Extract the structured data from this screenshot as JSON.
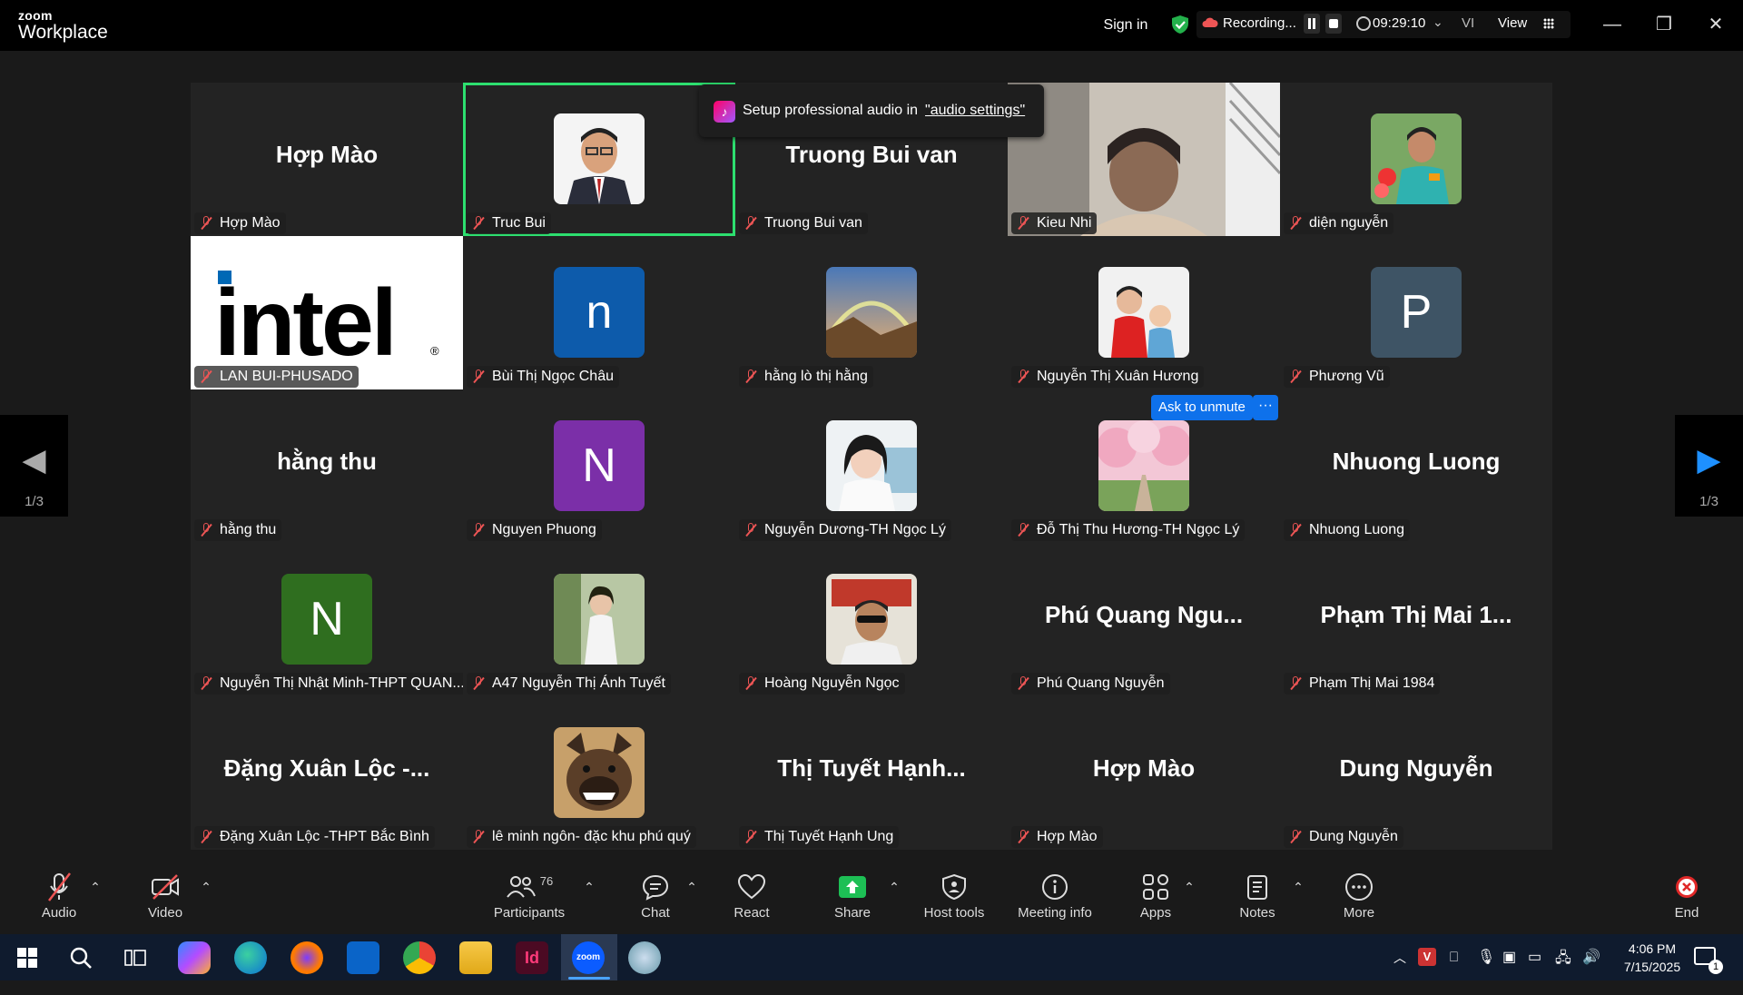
{
  "app": {
    "logo_top": "zoom",
    "logo_bottom": "Workplace"
  },
  "titlebar": {
    "signin": "Sign in",
    "recording": "Recording...",
    "timer": "09:29:10",
    "language": "VI",
    "view": "View"
  },
  "toast": {
    "text": "Setup professional audio in",
    "link": "\"audio settings\""
  },
  "participants": [
    {
      "display": "Hợp Mào",
      "label": "Hợp Mào"
    },
    {
      "display": "",
      "label": "Truc Bui"
    },
    {
      "display": "Truong Bui van",
      "label": "Truong Bui van"
    },
    {
      "display": "",
      "label": "Kieu Nhi"
    },
    {
      "display": "",
      "label": "diện nguyễn"
    },
    {
      "display": "intel",
      "label": "LAN BUI-PHUSADO"
    },
    {
      "display": "n",
      "label": "Bùi Thị Ngọc Châu"
    },
    {
      "display": "",
      "label": "hằng lò thị hằng"
    },
    {
      "display": "",
      "label": "Nguyễn Thị Xuân Hương"
    },
    {
      "display": "P",
      "label": "Phương Vũ"
    },
    {
      "display": "hằng thu",
      "label": "hằng thu"
    },
    {
      "display": "N",
      "label": "Nguyen Phuong"
    },
    {
      "display": "",
      "label": "Nguyễn Dương-TH Ngọc Lý"
    },
    {
      "display": "",
      "label": "Đỗ Thị Thu Hương-TH Ngọc Lý"
    },
    {
      "display": "Nhuong Luong",
      "label": "Nhuong Luong"
    },
    {
      "display": "N",
      "label": "Nguyễn Thị Nhật Minh-THPT QUAN..."
    },
    {
      "display": "",
      "label": "A47 Nguyễn Thị Ánh Tuyết"
    },
    {
      "display": "",
      "label": "Hoàng Nguyễn Ngọc"
    },
    {
      "display": "Phú Quang Ngu...",
      "label": "Phú Quang Nguyễn"
    },
    {
      "display": "Phạm Thị Mai 1...",
      "label": "Phạm Thị Mai 1984"
    },
    {
      "display": "Đặng Xuân Lộc -...",
      "label": "Đặng Xuân Lộc -THPT Bắc Bình"
    },
    {
      "display": "",
      "label": "lê minh ngôn- đặc khu phú quý"
    },
    {
      "display": "Thị Tuyết Hạnh...",
      "label": "Thị Tuyết Hạnh Ung"
    },
    {
      "display": "Hợp Mào",
      "label": "Hợp Mào"
    },
    {
      "display": "Dung Nguyễn",
      "label": "Dung Nguyễn"
    }
  ],
  "ask_unmute": {
    "label": "Ask to unmute",
    "more": "···"
  },
  "pager": {
    "left": "1/3",
    "right": "1/3"
  },
  "toolbar": {
    "audio": "Audio",
    "video": "Video",
    "participants": "Participants",
    "participants_count": "76",
    "chat": "Chat",
    "react": "React",
    "share": "Share",
    "host_tools": "Host tools",
    "meeting_info": "Meeting info",
    "apps": "Apps",
    "notes": "Notes",
    "more": "More",
    "end": "End"
  },
  "taskbar": {
    "time": "4:06 PM",
    "date": "7/15/2025",
    "notif_count": "1"
  },
  "colors": {
    "accent": "#0e71eb",
    "speaking": "#2ddf6f",
    "muted": "#e55555",
    "share": "#1dbf55"
  }
}
